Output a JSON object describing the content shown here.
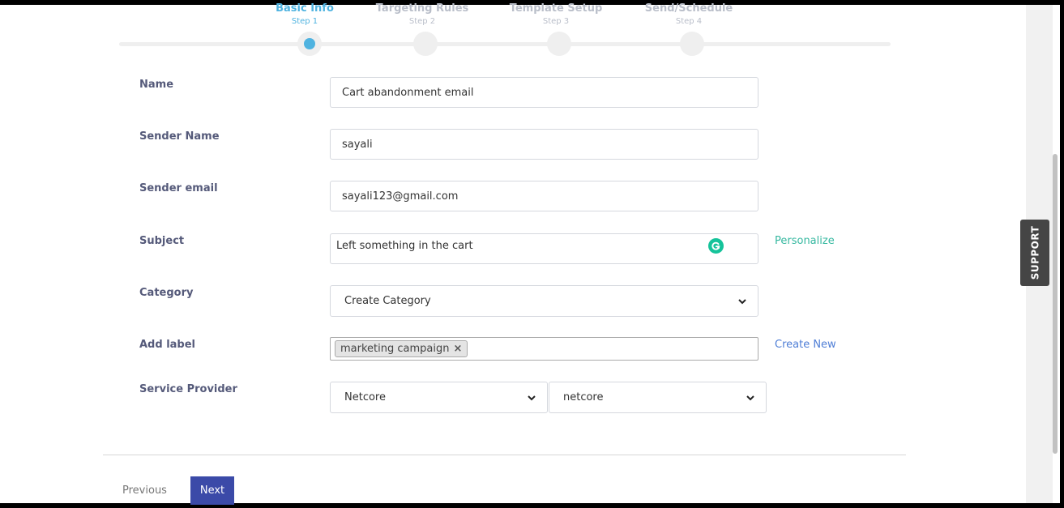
{
  "stepper": {
    "steps": [
      {
        "title": "Basic Info",
        "sub": "Step 1",
        "active": true
      },
      {
        "title": "Targeting Rules",
        "sub": "Step 2",
        "active": false
      },
      {
        "title": "Template Setup",
        "sub": "Step 3",
        "active": false
      },
      {
        "title": "Send/Schedule",
        "sub": "Step 4",
        "active": false
      }
    ]
  },
  "form": {
    "name_label": "Name",
    "name_value": "Cart abandonment email",
    "sender_name_label": "Sender Name",
    "sender_name_value": "sayali",
    "sender_email_label": "Sender email",
    "sender_email_value": "sayali123@gmail.com",
    "subject_label": "Subject",
    "subject_value": "Left something in the cart",
    "personalize_link": "Personalize",
    "category_label": "Category",
    "category_value": "Create Category",
    "add_label_label": "Add label",
    "label_tag": "marketing campaign",
    "label_tag_remove": "×",
    "create_new_link": "Create New",
    "service_provider_label": "Service Provider",
    "provider_value": "Netcore",
    "provider_account_value": "netcore"
  },
  "footer": {
    "previous_label": "Previous",
    "next_label": "Next"
  },
  "support_label": "SUPPORT",
  "colors": {
    "accent": "#4fb3e0",
    "primary_button": "#3b4aa8",
    "personalize": "#36b8a0",
    "create_new": "#4f7ed6",
    "grammarly": "#15c39a"
  }
}
